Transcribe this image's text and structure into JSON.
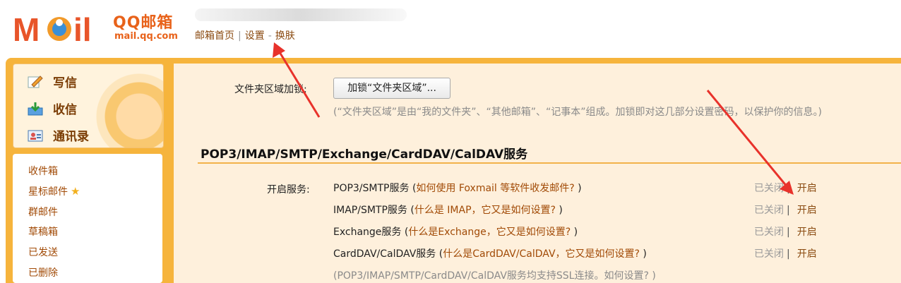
{
  "brand": {
    "name_cn": "QQ邮箱",
    "domain": "mail.qq.com"
  },
  "topnav": {
    "home": "邮箱首页",
    "settings": "设置",
    "skin": "换肤"
  },
  "sidebar": {
    "actions": [
      {
        "label": "写信",
        "icon": "pencil-paper-icon"
      },
      {
        "label": "收信",
        "icon": "inbox-download-icon"
      },
      {
        "label": "通讯录",
        "icon": "contact-card-icon"
      }
    ],
    "folders": [
      "收件箱",
      "星标邮件",
      "群邮件",
      "草稿箱",
      "已发送",
      "已删除"
    ]
  },
  "main": {
    "folder_lock_label": "文件夹区域加锁:",
    "folder_lock_button": "加锁“文件夹区域”...",
    "folder_lock_hint": "(“文件夹区域”是由“我的文件夹”、“其他邮箱”、“记事本”组成。加锁即对这几部分设置密码，以保护你的信息。)",
    "section_title": "POP3/IMAP/SMTP/Exchange/CardDAV/CalDAV服务",
    "enable_label": "开启服务:",
    "services": [
      {
        "name": "POP3/SMTP服务 (",
        "help": "如何使用 Foxmail 等软件收发邮件?",
        "close": " )",
        "status": "已关闭",
        "action": "开启"
      },
      {
        "name": "IMAP/SMTP服务 (",
        "help": "什么是 IMAP，它又是如何设置?",
        "close": " )",
        "status": "已关闭",
        "action": "开启"
      },
      {
        "name": "Exchange服务 (",
        "help": "什么是Exchange，它又是如何设置?",
        "close": " )",
        "status": "已关闭",
        "action": "开启"
      },
      {
        "name": "CardDAV/CalDAV服务 (",
        "help": "什么是CardDAV/CalDAV，它又是如何设置?",
        "close": " )",
        "status": "已关闭",
        "action": "开启"
      }
    ],
    "ssl_hint": "(POP3/IMAP/SMTP/CardDAV/CalDAV服务均支持SSL连接。如何设置? )",
    "separator": "|"
  },
  "colors": {
    "accent_orange": "#f6b43c",
    "link_brown": "#a14a06",
    "annotation_red": "#e8322b"
  }
}
